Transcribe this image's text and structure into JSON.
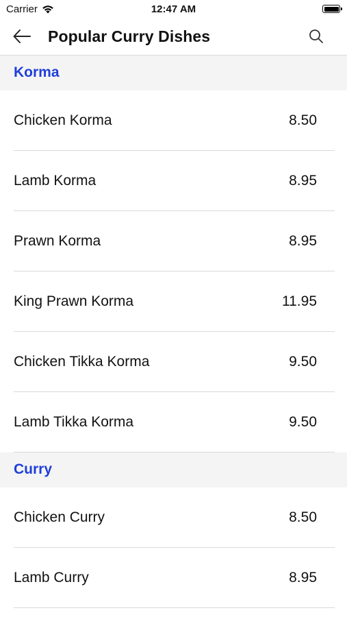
{
  "status": {
    "carrier": "Carrier",
    "time": "12:47 AM"
  },
  "nav": {
    "title": "Popular Curry Dishes",
    "back_icon": "arrow-left-icon",
    "search_icon": "search-icon"
  },
  "sections": [
    {
      "title": "Korma",
      "items": [
        {
          "name": "Chicken Korma",
          "price": "8.50"
        },
        {
          "name": "Lamb Korma",
          "price": "8.95"
        },
        {
          "name": "Prawn Korma",
          "price": "8.95"
        },
        {
          "name": "King Prawn Korma",
          "price": "11.95"
        },
        {
          "name": "Chicken Tikka Korma",
          "price": "9.50"
        },
        {
          "name": "Lamb Tikka Korma",
          "price": "9.50"
        }
      ]
    },
    {
      "title": "Curry",
      "items": [
        {
          "name": "Chicken Curry",
          "price": "8.50"
        },
        {
          "name": "Lamb Curry",
          "price": "8.95"
        }
      ]
    }
  ],
  "colors": {
    "section_title": "#1f3fd8",
    "section_bg": "#f4f4f4",
    "divider": "#d9d9d9"
  }
}
